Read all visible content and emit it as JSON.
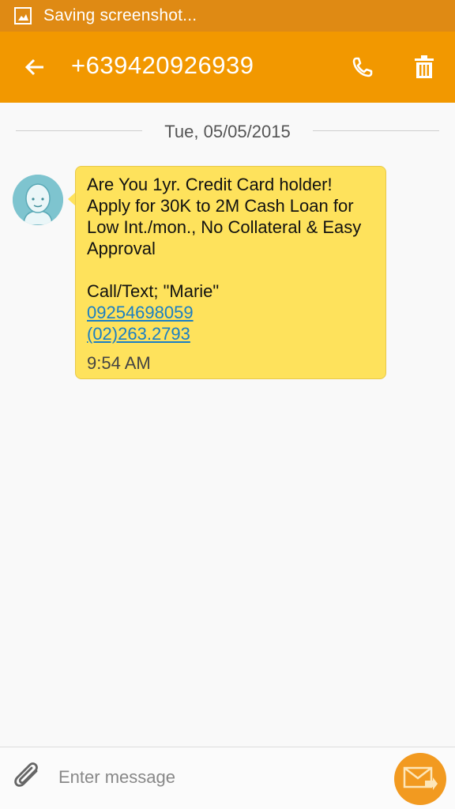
{
  "status_bar": {
    "text": "Saving screenshot...",
    "icon": "screenshot-icon"
  },
  "app_bar": {
    "back_icon": "arrow-left-icon",
    "title": "+639420926939",
    "call_icon": "phone-icon",
    "delete_icon": "trash-icon"
  },
  "conversation": {
    "date": "Tue, 05/05/2015",
    "messages": [
      {
        "lines": [
          "Are You 1yr. Credit Card holder!",
          "Apply for 30K to 2M Cash Loan for",
          "Low Int./mon., No Collateral & Easy",
          "Approval",
          "",
          "Call/Text; \"Marie\""
        ],
        "links": [
          "09254698059",
          "(02)263.2793"
        ],
        "time": "9:54 AM",
        "avatar": "contact-avatar-icon"
      }
    ]
  },
  "composer": {
    "attach_icon": "paperclip-icon",
    "placeholder": "Enter message",
    "send_icon": "send-message-icon"
  },
  "colors": {
    "status_bar": "#df8a14",
    "app_bar": "#f29800",
    "bubble": "#fee25c",
    "link": "#1a7fc4",
    "send_button": "#f29a20"
  }
}
